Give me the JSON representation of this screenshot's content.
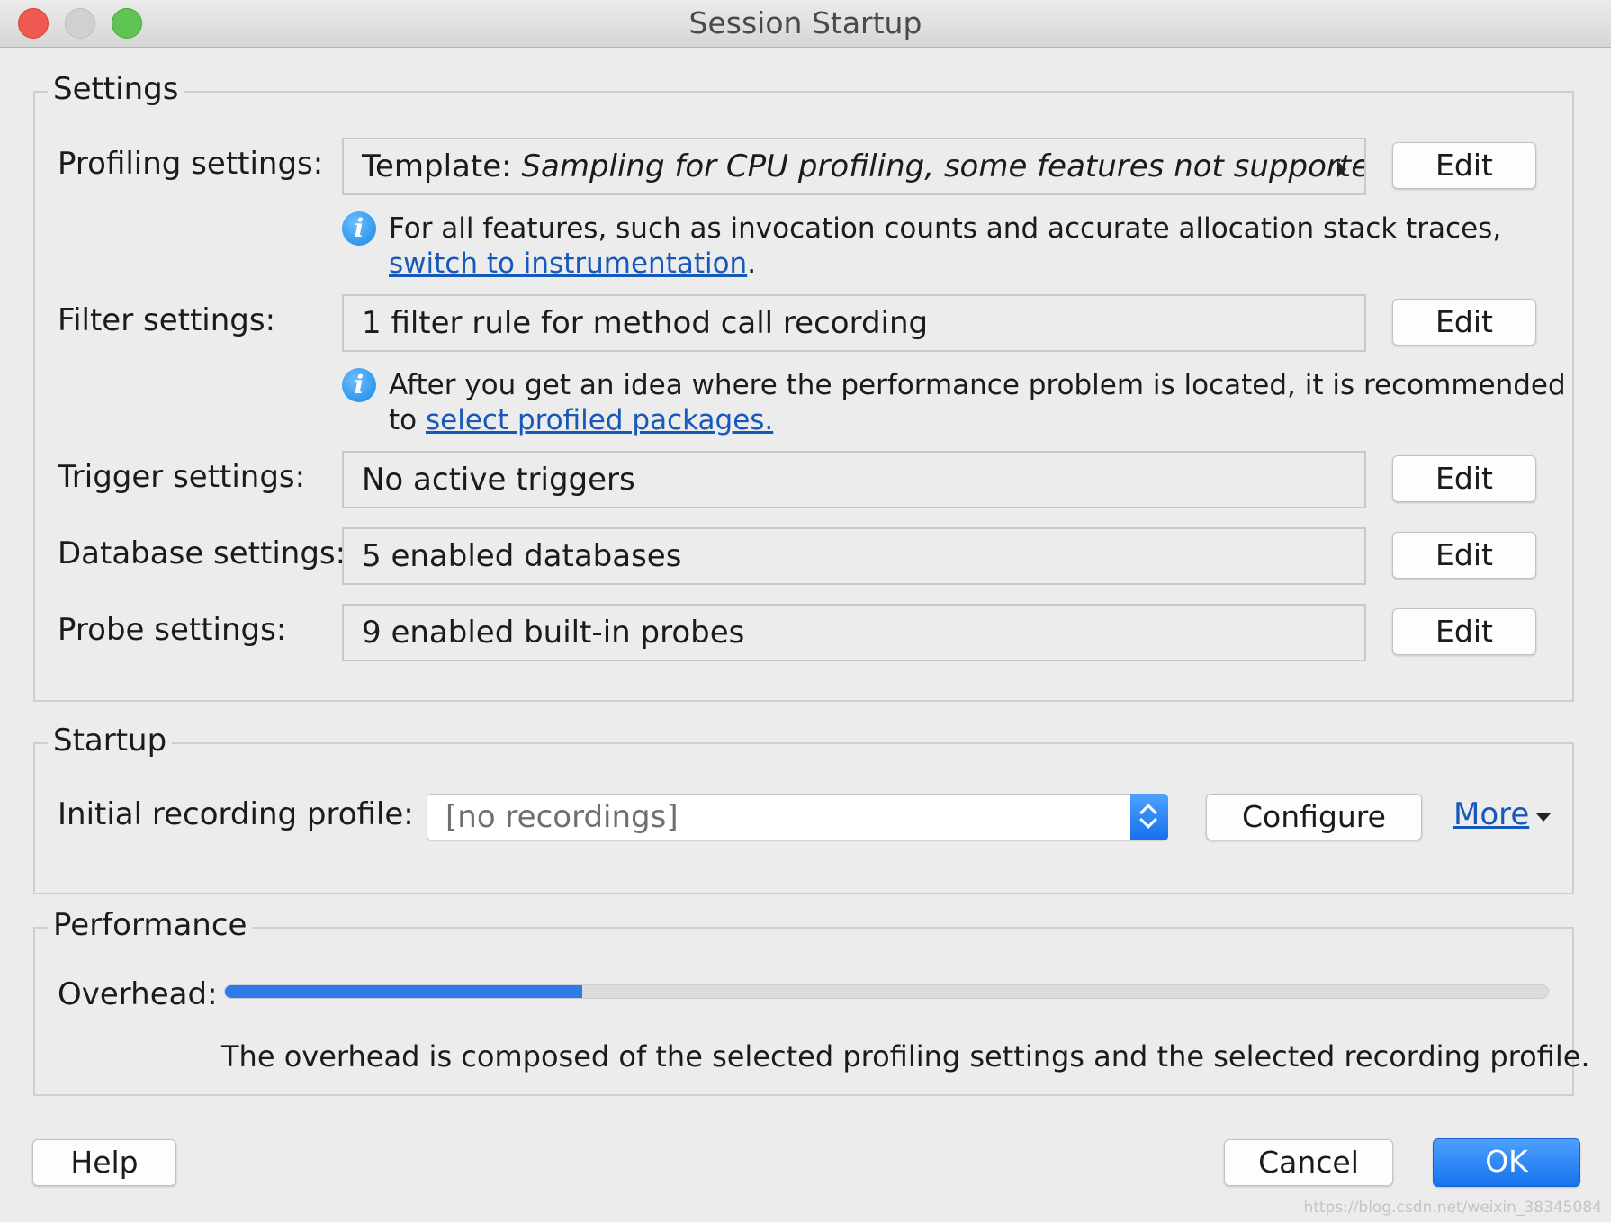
{
  "window": {
    "title": "Session Startup"
  },
  "settings": {
    "legend": "Settings",
    "profiling": {
      "label": "Profiling settings:",
      "prefix": "Template: ",
      "value": "Sampling for CPU profiling, some features not supporte",
      "edit": "Edit"
    },
    "profiling_info": {
      "text": "For all features, such as invocation counts and accurate allocation stack traces, ",
      "link": "switch to instrumentation",
      "suffix": "."
    },
    "filter": {
      "label": "Filter settings:",
      "value": "1 filter rule for method call recording",
      "edit": "Edit"
    },
    "filter_info": {
      "text": "After you get an idea where the performance problem is located, it is recommended to ",
      "link": "select profiled packages."
    },
    "trigger": {
      "label": "Trigger settings:",
      "value": "No active triggers",
      "edit": "Edit"
    },
    "database": {
      "label": "Database settings:",
      "value": "5 enabled databases",
      "edit": "Edit"
    },
    "probe": {
      "label": "Probe settings:",
      "value": "9 enabled built-in probes",
      "edit": "Edit"
    }
  },
  "startup": {
    "legend": "Startup",
    "label": "Initial recording profile:",
    "combo_value": "[no recordings]",
    "configure": "Configure",
    "more": "More"
  },
  "performance": {
    "legend": "Performance",
    "overhead_label": "Overhead:",
    "overhead_level": 0.27,
    "description": "The overhead is composed of the selected profiling settings and the selected recording profile."
  },
  "footer": {
    "help": "Help",
    "cancel": "Cancel",
    "ok": "OK"
  },
  "watermark": "https://blog.csdn.net/weixin_38345084",
  "icons": {
    "close": "close-icon",
    "minimize": "minimize-icon",
    "zoom": "zoom-icon",
    "info": "info-icon",
    "expand": "expand-arrow-icon",
    "stepper": "up-down-stepper-icon",
    "caret": "chevron-down-icon"
  },
  "colors": {
    "accent": "#1673ec",
    "link": "#1659b8",
    "progress": "#2e7ae8"
  }
}
